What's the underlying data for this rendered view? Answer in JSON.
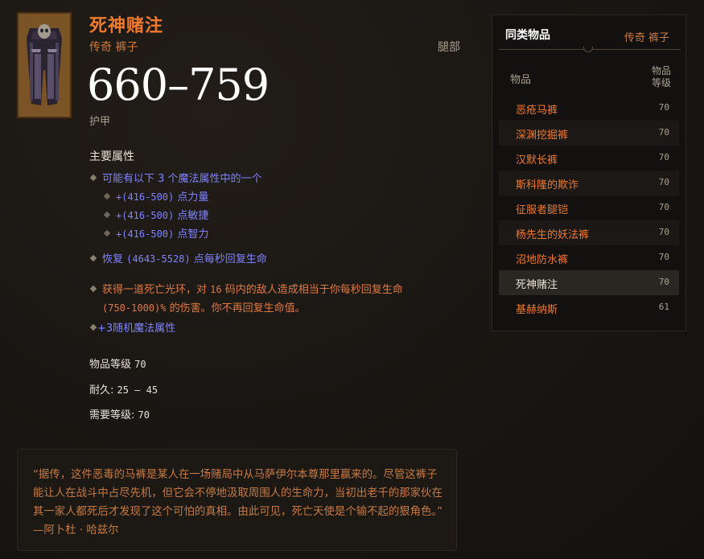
{
  "item": {
    "name": "死神赌注",
    "subtype": "传奇 裤子",
    "slot": "腿部",
    "armor_value": "660–759",
    "armor_label": "护甲",
    "primary_header": "主要属性",
    "random_affix_line": "可能有以下 3 个魔法属性中的一个",
    "random_affixes": [
      {
        "range": "+(416-500)",
        "stat": "点力量"
      },
      {
        "range": "+(416-500)",
        "stat": "点敏捷"
      },
      {
        "range": "+(416-500)",
        "stat": "点智力"
      }
    ],
    "regen_prefix": "恢复",
    "regen_range": "(4643-5528)",
    "regen_suffix": "点每秒回复生命",
    "legendary_line1_a": "获得一道死亡光环，对",
    "legendary_line1_num": "16",
    "legendary_line1_b": "码内的敌人造成相当于你每秒回复生命",
    "legendary_line2_num": "(750-1000)%",
    "legendary_line2_b": "的伤害。你不再回复生命值。",
    "random_magic": "+3随机魔法属性",
    "item_level_label": "物品等级",
    "item_level_value": "70",
    "durability_label": "耐久:",
    "durability_value": "25 – 45",
    "required_level_label": "需要等级:",
    "required_level_value": "70",
    "flavor_text": "“据传，这件恶毒的马裤是某人在一场赌局中从马萨伊尔本尊那里赢来的。尽管这裤子能让人在战斗中占尽先机，但它会不停地汲取周围人的生命力，当初出老千的那家伙在其一家人都死后才发现了这个可怕的真相。由此可见，死亡天使是个输不起的狠角色。” —阿卜杜 · 哈兹尔"
  },
  "similar": {
    "title": "同类物品",
    "subtitle": "传奇 裤子",
    "col_item": "物品",
    "col_level_1": "物品",
    "col_level_2": "等级",
    "rows": [
      {
        "name": "恶疮马裤",
        "level": "70"
      },
      {
        "name": "深渊挖掘裤",
        "level": "70"
      },
      {
        "name": "汉默长裤",
        "level": "70"
      },
      {
        "name": "斯科隆的欺诈",
        "level": "70"
      },
      {
        "name": "征服者腿铠",
        "level": "70"
      },
      {
        "name": "杨先生的妖法裤",
        "level": "70"
      },
      {
        "name": "沼地防水裤",
        "level": "70"
      },
      {
        "name": "死神赌注",
        "level": "70"
      },
      {
        "name": "基赫纳斯",
        "level": "61"
      }
    ]
  },
  "colors": {
    "legendary_orange": "#ef7a2e",
    "magic_blue": "#7f83ff",
    "current_row_highlight": "#2a2723"
  },
  "icons": {
    "item_thumbnail": "legendary-pants-icon",
    "bullet": "diamond-bullet-icon"
  }
}
